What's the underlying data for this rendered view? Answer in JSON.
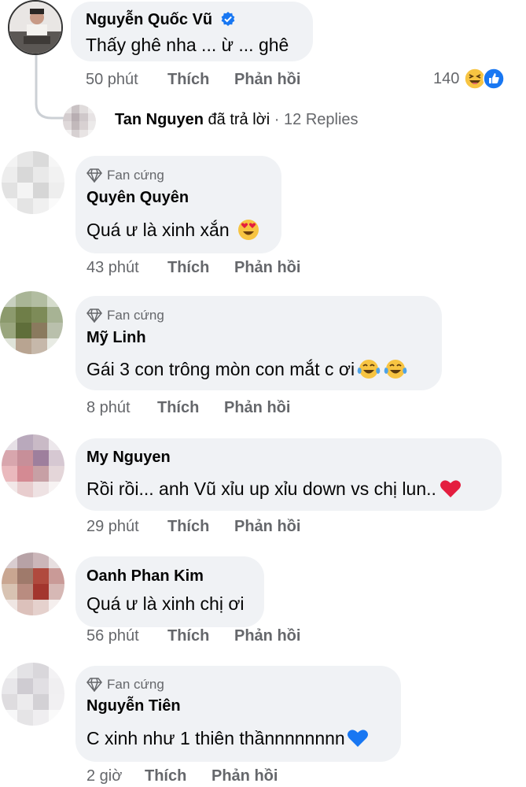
{
  "top_comment": {
    "author": "Nguyễn Quốc Vũ",
    "verified": true,
    "text": "Thấy ghê nha ... ừ ... ghê",
    "time": "50 phút",
    "like_label": "Thích",
    "reply_label": "Phản hồi",
    "reaction_count": "140",
    "reactions": [
      "haha-icon",
      "like-icon"
    ]
  },
  "reply_summary": {
    "author": "Tan Nguyen",
    "action": "đã trả lời",
    "separator": "·",
    "count_label": "12 Replies"
  },
  "comments": [
    {
      "badge": "Fan cứng",
      "author": "Quyên Quyên",
      "text": "Quá ư là xinh xắn",
      "emoji": "heart-eyes-emoji",
      "time": "43 phút",
      "like_label": "Thích",
      "reply_label": "Phản hồi"
    },
    {
      "badge": "Fan cứng",
      "author": "Mỹ Linh",
      "text": "Gái 3 con trông mòn con mắt c ơi",
      "emoji": "tears-of-joy-emoji",
      "time": "8 phút",
      "like_label": "Thích",
      "reply_label": "Phản hồi"
    },
    {
      "author": "My Nguyen",
      "text": "Rồi rồi... anh Vũ xỉu up xỉu down vs chị lun..",
      "emoji": "red-heart-emoji",
      "time": "29 phút",
      "like_label": "Thích",
      "reply_label": "Phản hồi"
    },
    {
      "author": "Oanh Phan Kim",
      "text": "Quá ư là xinh chị ơi",
      "time": "56 phút",
      "like_label": "Thích",
      "reply_label": "Phản hồi"
    },
    {
      "badge": "Fan cứng",
      "author": "Nguyễn Tiên",
      "text": "C xinh như 1 thiên thầnnnnnnnn",
      "emoji": "blue-heart-emoji",
      "time": "2 giờ",
      "like_label": "Thích",
      "reply_label": "Phản hồi"
    }
  ],
  "colors": {
    "bubble": "#f0f2f5",
    "meta_text": "#65676b",
    "verified_blue": "#1877f2",
    "heart_red": "#e41e3f",
    "heart_blue": "#1877f2"
  }
}
